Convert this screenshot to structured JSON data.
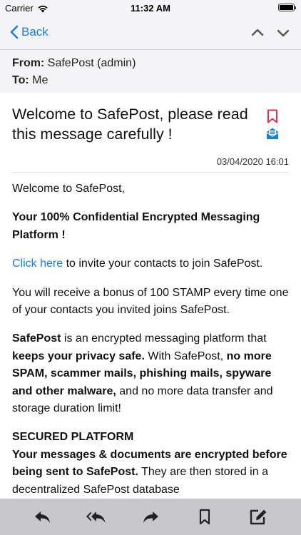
{
  "status_bar": {
    "carrier": "Carrier",
    "time": "11:32 AM",
    "battery_level": 1.0
  },
  "nav": {
    "back_label": "Back",
    "icons": [
      "chevron-up-icon",
      "chevron-down-icon"
    ]
  },
  "header": {
    "from_label": "From:",
    "from_value": "SafePost (admin)",
    "to_label": "To:",
    "to_value": "Me"
  },
  "message": {
    "subject": "Welcome to SafePost, please read this message carefully !",
    "date": "03/04/2020 16:01",
    "accent_color": "#1a7ee0",
    "bookmark_color": "#e0344a"
  },
  "body": {
    "greeting": "Welcome to SafePost,",
    "tagline": "Your 100% Confidential Encrypted Messaging Platform !",
    "invite_link": "Click here",
    "invite_rest": " to invite your contacts to join SafePost.",
    "bonus": "You will receive a bonus of 100 STAMP every time one of your contacts you invited joins SafePost.",
    "p4_a": "SafePost",
    "p4_b": " is an encrypted messaging platform that ",
    "p4_c": "keeps your privacy safe.",
    "p4_d": " With SafePost, ",
    "p4_e": "no more SPAM, scammer mails, phishing mails, spyware and other malware,",
    "p4_f": " and no more data transfer and storage duration limit!",
    "section_title": "SECURED PLATFORM",
    "p5_a": "Your messages & documents are encrypted before being sent to SafePost.",
    "p5_b": " They are then stored in a decentralized SafePost database"
  },
  "toolbar": {
    "icons": [
      "reply-icon",
      "reply-all-icon",
      "forward-icon",
      "bookmark-icon",
      "compose-icon"
    ]
  }
}
